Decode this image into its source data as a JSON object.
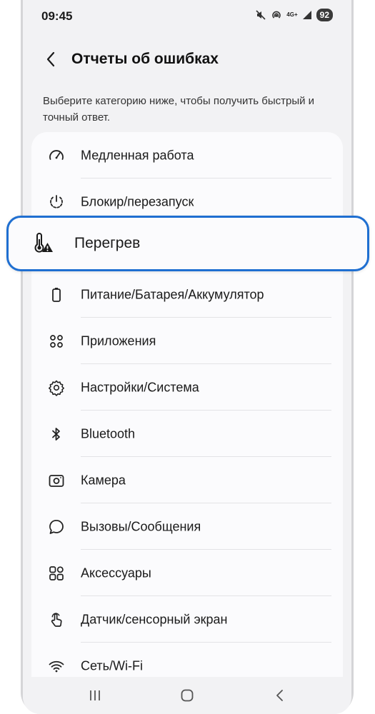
{
  "status_bar": {
    "time": "09:45",
    "network_label": "4G+",
    "battery": "92",
    "icons": [
      "mute-icon",
      "hotspot-icon",
      "signal-icon",
      "battery-icon"
    ]
  },
  "header": {
    "title": "Отчеты об ошибках",
    "back_icon": "chevron-left-icon"
  },
  "description": "Выберите категорию ниже, чтобы получить быстрый и точный ответ.",
  "categories": [
    {
      "label": "Медленная работа",
      "icon": "speedometer-icon"
    },
    {
      "label": "Блокир/перезапуск",
      "icon": "power-restart-icon"
    },
    {
      "label": "Перегрев",
      "icon": "thermometer-warning-icon",
      "highlighted": true
    },
    {
      "label": "Питание/Батарея/Аккумулятор",
      "icon": "battery-icon"
    },
    {
      "label": "Приложения",
      "icon": "apps-grid-icon"
    },
    {
      "label": "Настройки/Система",
      "icon": "gear-icon"
    },
    {
      "label": "Bluetooth",
      "icon": "bluetooth-icon"
    },
    {
      "label": "Камера",
      "icon": "camera-icon"
    },
    {
      "label": "Вызовы/Сообщения",
      "icon": "chat-bubble-icon"
    },
    {
      "label": "Аксессуары",
      "icon": "accessories-icon"
    },
    {
      "label": "Датчик/сенсорный экран",
      "icon": "touch-icon"
    },
    {
      "label": "Сеть/Wi-Fi",
      "icon": "wifi-icon"
    }
  ],
  "nav_bar": [
    "recents-icon",
    "home-icon",
    "back-icon"
  ],
  "colors": {
    "accent": "#1f6fd1",
    "screen_bg": "#f2f2f4",
    "card_bg": "#fbfbfd",
    "text": "#1a1a1a"
  }
}
